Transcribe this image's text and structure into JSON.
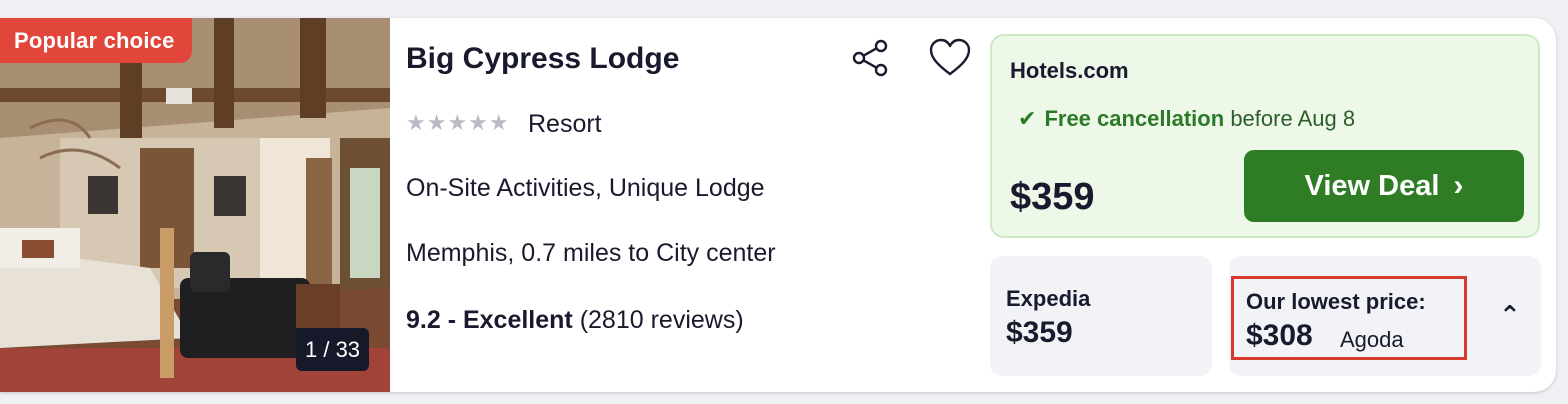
{
  "listing": {
    "badge": "Popular choice",
    "photo_counter": "1 / 33",
    "name": "Big Cypress Lodge",
    "stars": "★★★★★",
    "type": "Resort",
    "amenities": "On-Site Activities, Unique Lodge",
    "location": "Memphis, 0.7 miles to City center",
    "rating_score": "9.2 - Excellent",
    "rating_reviews": "(2810 reviews)"
  },
  "featured_deal": {
    "provider": "Hotels.com",
    "cancel_check": "✔",
    "cancel_label": "Free cancellation",
    "cancel_rest": "before Aug 8",
    "price": "$359",
    "button_label": "View Deal",
    "button_chevron": "›"
  },
  "offers": [
    {
      "provider": "Expedia",
      "price": "$359"
    }
  ],
  "lowest": {
    "label": "Our lowest price:",
    "price": "$308",
    "provider": "Agoda",
    "toggle": "⌃"
  },
  "icons": {
    "share": "share-icon",
    "favorite": "heart-icon",
    "check": "check-icon",
    "collapse": "chevron-up-icon"
  },
  "colors": {
    "badge": "#e2463b",
    "deal_bg": "#eef8e9",
    "deal_button": "#2e7d25",
    "cancel_text": "#2c7a28",
    "highlight_border": "#d63a2f"
  }
}
